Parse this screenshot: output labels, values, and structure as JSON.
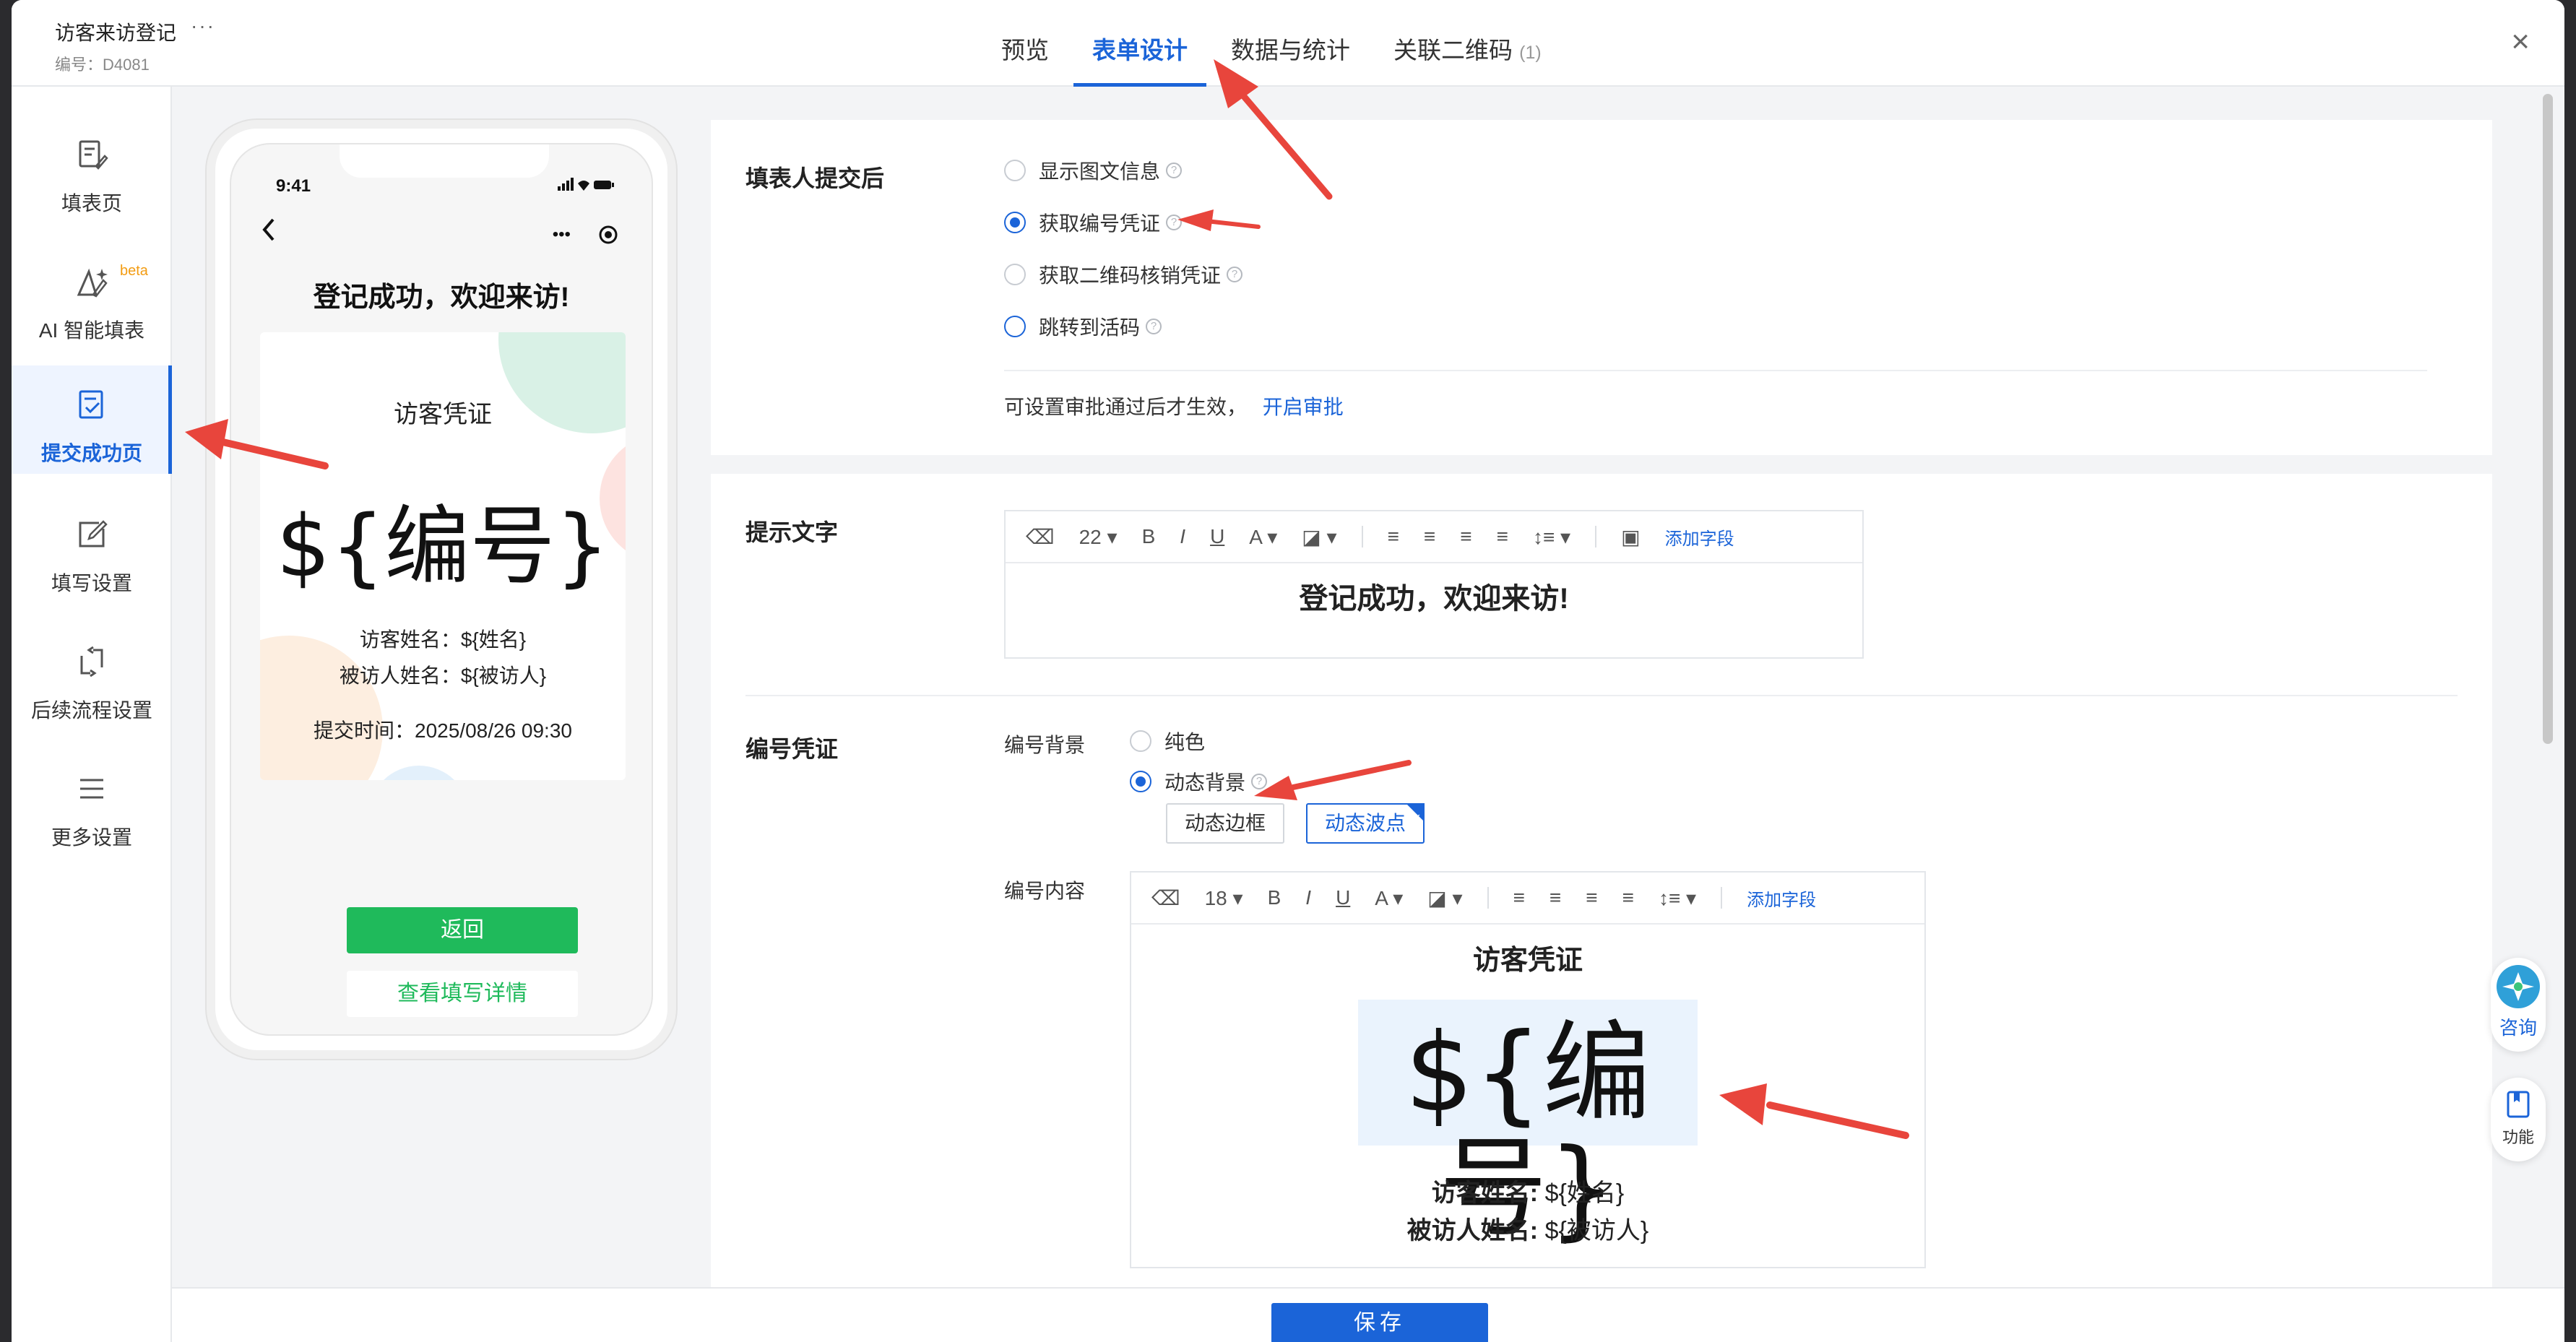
{
  "header": {
    "doc_title": "访客来访登记",
    "more_label": "···",
    "doc_id": "编号：D4081",
    "tabs": [
      {
        "label": "预览"
      },
      {
        "label": "表单设计",
        "active": true
      },
      {
        "label": "数据与统计"
      },
      {
        "label": "关联二维码",
        "count": "(1)"
      }
    ],
    "close_label": "×"
  },
  "sidebar": {
    "items": [
      {
        "label": "填表页",
        "icon": "form-edit-icon"
      },
      {
        "label": "AI 智能填表",
        "icon": "ai-fill-icon",
        "badge": "beta"
      },
      {
        "label": "提交成功页",
        "icon": "success-check-icon",
        "active": true
      },
      {
        "label": "填写设置",
        "icon": "settings-edit-icon"
      },
      {
        "label": "后续流程设置",
        "icon": "flow-icon"
      },
      {
        "label": "更多设置",
        "icon": "menu-icon"
      }
    ]
  },
  "phone": {
    "time": "9:41",
    "title": "登记成功，欢迎来访!",
    "card_title": "访客凭证",
    "card_number": "${编号}",
    "visitor_line": "访客姓名：${姓名}",
    "host_line": "被访人姓名：${被访人}",
    "submit_time": "提交时间：2025/08/26 09:30",
    "btn_back": "返回",
    "btn_detail": "查看填写详情"
  },
  "after_submit": {
    "label": "填表人提交后",
    "options": [
      {
        "label": "显示图文信息",
        "checked": false
      },
      {
        "label": "获取编号凭证",
        "checked": true
      },
      {
        "label": "获取二维码核销凭证",
        "checked": false
      },
      {
        "label": "跳转到活码",
        "checked": false
      }
    ],
    "hint": "可设置审批通过后才生效，",
    "hint_link": "开启审批"
  },
  "tip_text": {
    "label": "提示文字",
    "toolbar": {
      "font_size": "22",
      "add_field": "添加字段"
    },
    "content": "登记成功，欢迎来访!"
  },
  "number_voucher": {
    "label": "编号凭证",
    "bg_label": "编号背景",
    "bg_options": [
      {
        "label": "纯色",
        "checked": false
      },
      {
        "label": "动态背景",
        "checked": true
      }
    ],
    "styles": [
      {
        "label": "动态边框",
        "selected": false
      },
      {
        "label": "动态波点",
        "selected": true
      }
    ],
    "content_label": "编号内容",
    "toolbar": {
      "font_size": "18",
      "add_field": "添加字段"
    },
    "content_title": "访客凭证",
    "content_number": "${编号}",
    "visitor_label": "访客姓名:",
    "visitor_value": "${姓名}",
    "host_label": "被访人姓名:",
    "host_value": "${被访人}"
  },
  "footer": {
    "save_label": "保存"
  },
  "float": {
    "consult_label": "咨询",
    "feature_label": "功能"
  },
  "colors": {
    "accent": "#1b64d8",
    "green": "#1fba5b",
    "annotation": "#e8453c"
  }
}
